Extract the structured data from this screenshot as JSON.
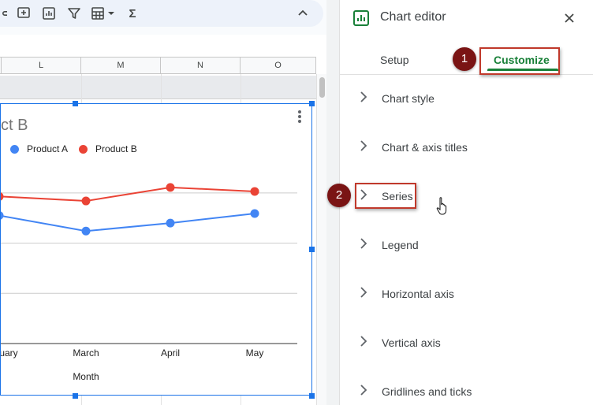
{
  "toolbar": {
    "icons": [
      "link-icon",
      "insert-comment-icon",
      "insert-chart-icon",
      "filter-icon",
      "filter-views-icon",
      "functions-icon",
      "collapse-icon"
    ],
    "functions_glyph": "Σ"
  },
  "sheet": {
    "columns": [
      "L",
      "M",
      "N",
      "O"
    ]
  },
  "chart": {
    "title_partial": "ct B",
    "legend": [
      {
        "label": "Product A",
        "color": "#4285f4"
      },
      {
        "label": "Product B",
        "color": "#ea4335"
      }
    ],
    "x_axis_title": "Month"
  },
  "chart_data": {
    "type": "line",
    "x_categories_visible": [
      "ruary",
      "March",
      "April",
      "May"
    ],
    "x": [
      "February",
      "March",
      "April",
      "May"
    ],
    "series": [
      {
        "name": "Product A",
        "color": "#4285f4",
        "values": [
          255,
          224,
          240,
          259
        ]
      },
      {
        "name": "Product B",
        "color": "#ea4335",
        "values": [
          293,
          284,
          311,
          303
        ]
      }
    ],
    "ylim": [
      0,
      350
    ],
    "xlabel": "Month",
    "grid": true,
    "legend_position": "top-left"
  },
  "editor": {
    "title": "Chart editor",
    "tabs": {
      "setup": "Setup",
      "customize": "Customize"
    },
    "sections": [
      "Chart style",
      "Chart & axis titles",
      "Series",
      "Legend",
      "Horizontal axis",
      "Vertical axis",
      "Gridlines and ticks"
    ],
    "steps": [
      "1",
      "2"
    ]
  }
}
